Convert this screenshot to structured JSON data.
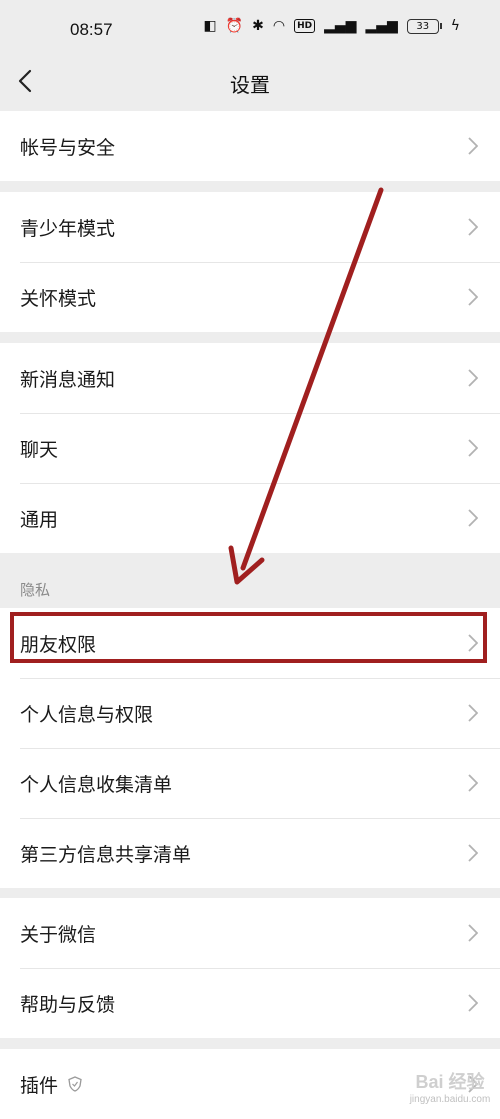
{
  "status": {
    "time": "08:57",
    "hd": "HD",
    "battery": "33"
  },
  "header": {
    "title": "设置"
  },
  "groups": [
    {
      "items": [
        {
          "label": "帐号与安全"
        }
      ]
    },
    {
      "items": [
        {
          "label": "青少年模式"
        },
        {
          "label": "关怀模式"
        }
      ]
    },
    {
      "items": [
        {
          "label": "新消息通知"
        },
        {
          "label": "聊天"
        },
        {
          "label": "通用"
        }
      ]
    },
    {
      "section": "隐私",
      "items": [
        {
          "label": "朋友权限"
        },
        {
          "label": "个人信息与权限"
        },
        {
          "label": "个人信息收集清单"
        },
        {
          "label": "第三方信息共享清单"
        }
      ]
    },
    {
      "items": [
        {
          "label": "关于微信"
        },
        {
          "label": "帮助与反馈"
        }
      ]
    },
    {
      "items": [
        {
          "label": "插件"
        }
      ]
    }
  ],
  "annotation": {
    "color": "#a01f1f"
  },
  "watermark": {
    "brand": "Bai 经验",
    "url": "jingyan.baidu.com"
  },
  "icons": {
    "back": "chevron-left-icon",
    "row_arrow": "chevron-right-icon",
    "plugin": "shield-icon"
  }
}
